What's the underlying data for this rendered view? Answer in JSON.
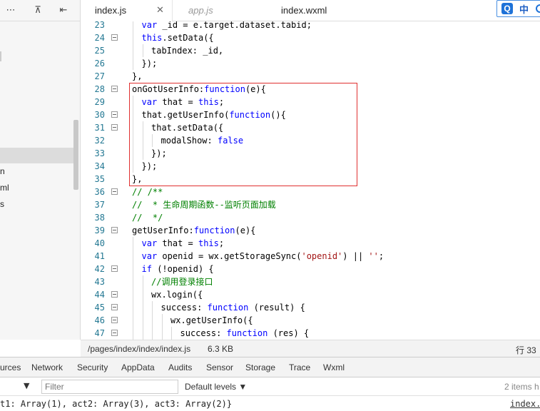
{
  "sidebar": {
    "toolbar": {
      "more_icon": "⋯",
      "collapse_icon": "⊼",
      "back_icon": "⇤"
    },
    "items": [
      {
        "label": "n"
      },
      {
        "label": "ml"
      },
      {
        "label": "s"
      }
    ]
  },
  "tabs": [
    {
      "label": "index.js",
      "active": true,
      "close": "✕"
    },
    {
      "label": "app.js",
      "active": false,
      "italic": true
    },
    {
      "label": "index.wxml",
      "active": false
    }
  ],
  "ime": {
    "logo": "Q",
    "text": "中"
  },
  "editor": {
    "lines": [
      {
        "n": "23",
        "fold": false,
        "indent": 1,
        "tokens": [
          {
            "t": "var ",
            "c": "kw"
          },
          {
            "t": "_id = e.target.dataset.tabid;"
          }
        ]
      },
      {
        "n": "24",
        "fold": true,
        "indent": 1,
        "tokens": [
          {
            "t": "this",
            "c": "kw"
          },
          {
            "t": ".setData({"
          }
        ]
      },
      {
        "n": "25",
        "fold": false,
        "indent": 2,
        "tokens": [
          {
            "t": "tabIndex: _id,"
          }
        ]
      },
      {
        "n": "26",
        "fold": false,
        "indent": 1,
        "tokens": [
          {
            "t": "});"
          }
        ]
      },
      {
        "n": "27",
        "fold": false,
        "indent": 0,
        "tokens": [
          {
            "t": "},"
          }
        ]
      },
      {
        "n": "28",
        "fold": true,
        "indent": 0,
        "tokens": [
          {
            "t": "onGotUserInfo:"
          },
          {
            "t": "function",
            "c": "kw"
          },
          {
            "t": "(e){"
          }
        ]
      },
      {
        "n": "29",
        "fold": false,
        "indent": 1,
        "tokens": [
          {
            "t": "var ",
            "c": "kw"
          },
          {
            "t": "that = "
          },
          {
            "t": "this",
            "c": "kw"
          },
          {
            "t": ";"
          }
        ]
      },
      {
        "n": "30",
        "fold": true,
        "indent": 1,
        "tokens": [
          {
            "t": "that.getUserInfo("
          },
          {
            "t": "function",
            "c": "kw"
          },
          {
            "t": "(){"
          }
        ]
      },
      {
        "n": "31",
        "fold": true,
        "indent": 2,
        "tokens": [
          {
            "t": "that.setData({"
          }
        ]
      },
      {
        "n": "32",
        "fold": false,
        "indent": 3,
        "tokens": [
          {
            "t": "modalShow: "
          },
          {
            "t": "false",
            "c": "kw"
          }
        ]
      },
      {
        "n": "33",
        "fold": false,
        "indent": 2,
        "tokens": [
          {
            "t": "});"
          }
        ]
      },
      {
        "n": "34",
        "fold": false,
        "indent": 1,
        "tokens": [
          {
            "t": "});"
          }
        ]
      },
      {
        "n": "35",
        "fold": false,
        "indent": 0,
        "tokens": [
          {
            "t": "},"
          }
        ]
      },
      {
        "n": "36",
        "fold": true,
        "indent": 0,
        "tokens": [
          {
            "t": "// /**",
            "c": "cm"
          }
        ]
      },
      {
        "n": "37",
        "fold": false,
        "indent": 0,
        "tokens": [
          {
            "t": "//  * 生命周期函数--监听页面加载",
            "c": "cm"
          }
        ]
      },
      {
        "n": "38",
        "fold": false,
        "indent": 0,
        "tokens": [
          {
            "t": "//  */",
            "c": "cm"
          }
        ]
      },
      {
        "n": "39",
        "fold": true,
        "indent": 0,
        "tokens": [
          {
            "t": "getUserInfo:"
          },
          {
            "t": "function",
            "c": "kw"
          },
          {
            "t": "(e){"
          }
        ]
      },
      {
        "n": "40",
        "fold": false,
        "indent": 1,
        "tokens": [
          {
            "t": "var ",
            "c": "kw"
          },
          {
            "t": "that = "
          },
          {
            "t": "this",
            "c": "kw"
          },
          {
            "t": ";"
          }
        ]
      },
      {
        "n": "41",
        "fold": false,
        "indent": 1,
        "tokens": [
          {
            "t": "var ",
            "c": "kw"
          },
          {
            "t": "openid = wx.getStorageSync("
          },
          {
            "t": "'openid'",
            "c": "str"
          },
          {
            "t": ") || "
          },
          {
            "t": "''",
            "c": "str"
          },
          {
            "t": ";"
          }
        ]
      },
      {
        "n": "42",
        "fold": true,
        "indent": 1,
        "tokens": [
          {
            "t": "if ",
            "c": "kw"
          },
          {
            "t": "(!openid) {"
          }
        ]
      },
      {
        "n": "43",
        "fold": false,
        "indent": 2,
        "tokens": [
          {
            "t": "//调用登录接口",
            "c": "cm"
          }
        ]
      },
      {
        "n": "44",
        "fold": true,
        "indent": 2,
        "tokens": [
          {
            "t": "wx.login({"
          }
        ]
      },
      {
        "n": "45",
        "fold": true,
        "indent": 3,
        "tokens": [
          {
            "t": "success: "
          },
          {
            "t": "function ",
            "c": "kw"
          },
          {
            "t": "(result) {"
          }
        ]
      },
      {
        "n": "46",
        "fold": true,
        "indent": 4,
        "tokens": [
          {
            "t": "wx.getUserInfo({"
          }
        ]
      },
      {
        "n": "47",
        "fold": true,
        "indent": 5,
        "tokens": [
          {
            "t": "success: "
          },
          {
            "t": "function ",
            "c": "kw"
          },
          {
            "t": "(res) {"
          }
        ]
      }
    ]
  },
  "status": {
    "path": "/pages/index/index/index.js",
    "size": "6.3 KB",
    "position": "行 33"
  },
  "devtools": {
    "tabs": [
      "urces",
      "Network",
      "Security",
      "AppData",
      "Audits",
      "Sensor",
      "Storage",
      "Trace",
      "Wxml"
    ],
    "context_caret": "▼",
    "filter_placeholder": "Filter",
    "levels": "Default levels ▼",
    "items_hidden": "2 items h",
    "console_message": "t1: Array(1), act2: Array(3), act3: Array(2)}",
    "console_source": "index.j"
  }
}
